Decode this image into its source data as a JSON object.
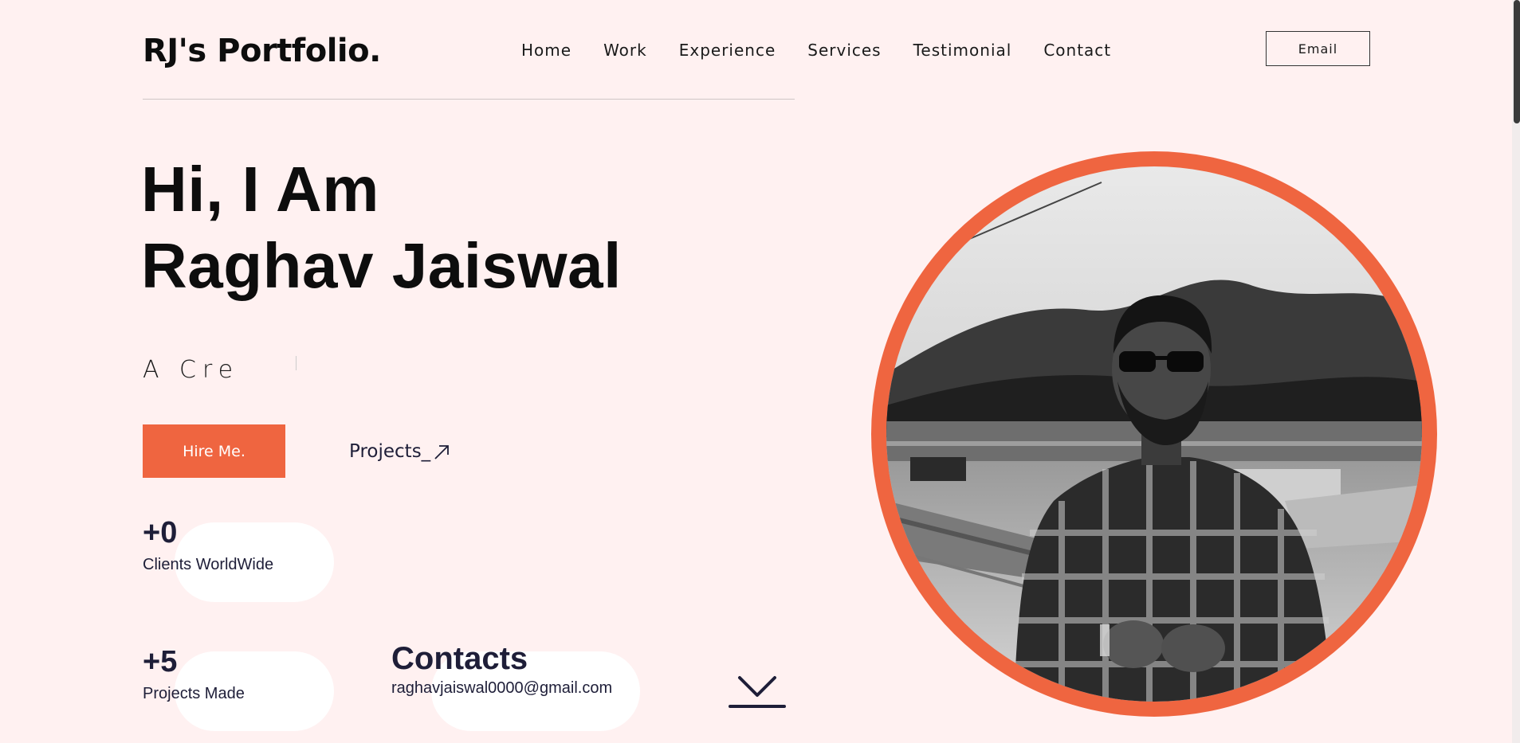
{
  "header": {
    "logo": "RJ's Portfolio.",
    "nav": {
      "home": "Home",
      "work": "Work",
      "experience": "Experience",
      "services": "Services",
      "testimonial": "Testimonial",
      "contact": "Contact"
    },
    "email_button": "Email"
  },
  "hero": {
    "line1": "Hi, I Am",
    "line2": "Raghav Jaiswal",
    "typed_text": "A Cre",
    "hire_button": "Hire Me.",
    "projects_link": "Projects_"
  },
  "stats": {
    "clients": {
      "value": "+0",
      "label": "Clients WorldWide"
    },
    "projects": {
      "value": "+5",
      "label": "Projects Made"
    }
  },
  "contacts": {
    "title": "Contacts",
    "email": "raghavjaiswal0000@gmail.com"
  },
  "icons": {
    "projects_arrow": "arrow-up-right-icon",
    "scroll": "chevron-down-icon"
  },
  "colors": {
    "background": "#fff1f1",
    "accent": "#ef6540",
    "text_dark": "#1e1e38"
  }
}
